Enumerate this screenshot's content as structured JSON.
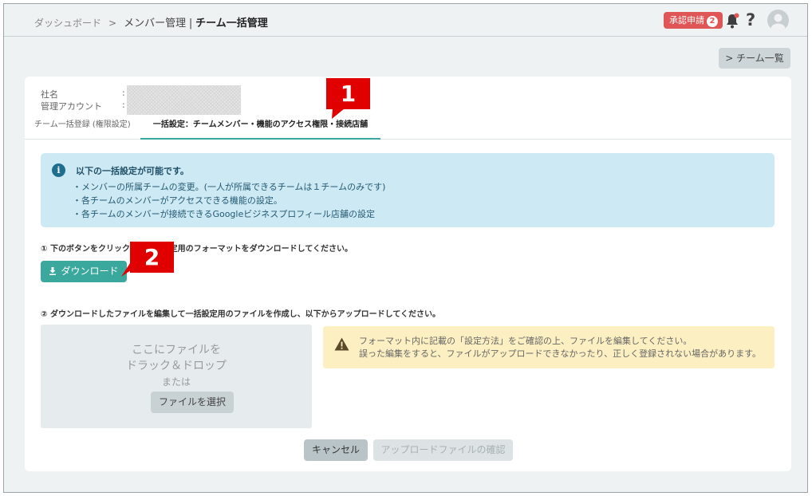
{
  "breadcrumb": {
    "dashboard": "ダッシュボード",
    "separator": ">",
    "members": "メンバー管理",
    "divider": "|",
    "current": "チーム一括管理"
  },
  "header": {
    "approval_label": "承認申請",
    "approval_count": "2",
    "help_label": "?"
  },
  "team_list_button": "> チーム一覧",
  "company_info": {
    "company_label": "社名",
    "account_label": "管理アカウント",
    "colon": ":"
  },
  "tabs": [
    {
      "label": "チーム一括登録 (権限設定)",
      "active": false
    },
    {
      "label": "一括設定：チームメンバー・機能のアクセス権限・接続店舗",
      "active": true
    }
  ],
  "notice": {
    "title": "以下の一括設定が可能です。",
    "lines": [
      "・メンバーの所属チームの変更。(一人が所属できるチームは１チームのみです)",
      "・各チームのメンバーがアクセスできる機能の設定。",
      "・各チームのメンバーが接続できるGoogleビジネスプロフィール店舗の設定"
    ]
  },
  "step1": "① 下のボタンをクリックして一括設定用のフォーマットをダウンロードしてください。",
  "download_button": "ダウンロード",
  "step2": "② ダウンロードしたファイルを編集して一括設定用のファイルを作成し、以下からアップロードしてください。",
  "dropzone": {
    "line1": "ここにファイルを",
    "line2": "ドラック＆ドロップ",
    "or": "または",
    "select_button": "ファイルを選択"
  },
  "warning": {
    "line1": "フォーマット内に記載の「設定方法」をご確認の上、ファイルを編集してください。",
    "line2": "誤った編集をすると、ファイルがアップロードできなかったり、正しく登録されない場合があります。"
  },
  "footer": {
    "cancel": "キャンセル",
    "confirm": "アップロードファイルの確認"
  },
  "markers": [
    "1",
    "2"
  ],
  "colors": {
    "accent": "#3aa89c",
    "badge": "#e05555",
    "notice_bg": "#cde9f4",
    "warning_bg": "#fcefc2",
    "marker": "#e00000"
  }
}
